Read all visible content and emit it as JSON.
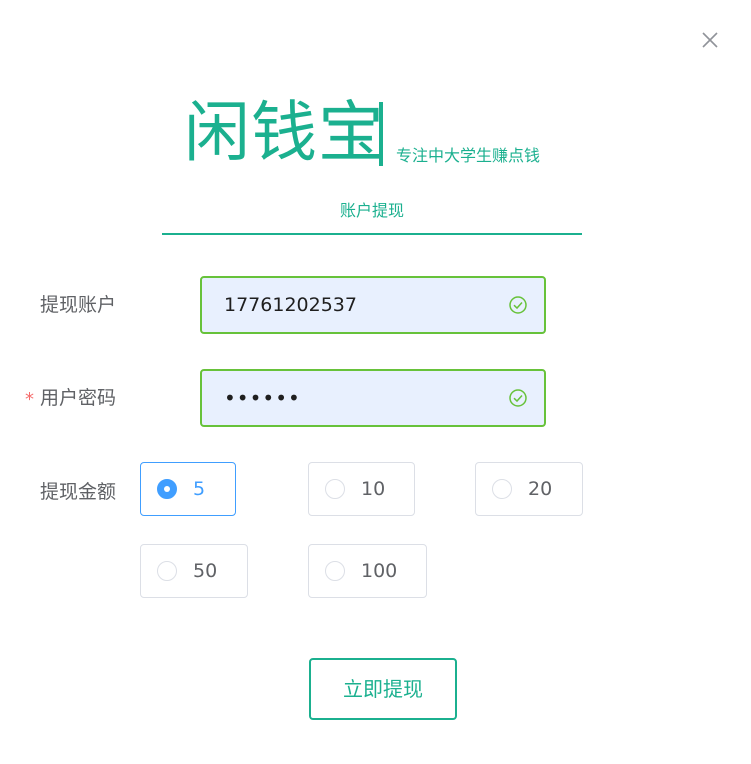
{
  "brand": {
    "name": "闲钱宝",
    "slogan": "专注中大学生赚点钱",
    "color": "#1bb08f"
  },
  "tab": {
    "label": "账户提现"
  },
  "form": {
    "account": {
      "label": "提现账户",
      "value": "17761202537",
      "status": "valid"
    },
    "password": {
      "label": "用户密码",
      "required": true,
      "value": "••••••",
      "status": "valid"
    },
    "amount": {
      "label": "提现金额",
      "options": [
        "5",
        "10",
        "20",
        "50",
        "100"
      ],
      "selected": "5"
    }
  },
  "submit": {
    "label": "立即提现"
  },
  "icons": {
    "close": "close-icon",
    "valid": "check-circle-icon"
  },
  "colors": {
    "accent": "#1bb08f",
    "valid": "#67c23a",
    "radio_selected": "#409eff",
    "required": "#f56c6c"
  }
}
